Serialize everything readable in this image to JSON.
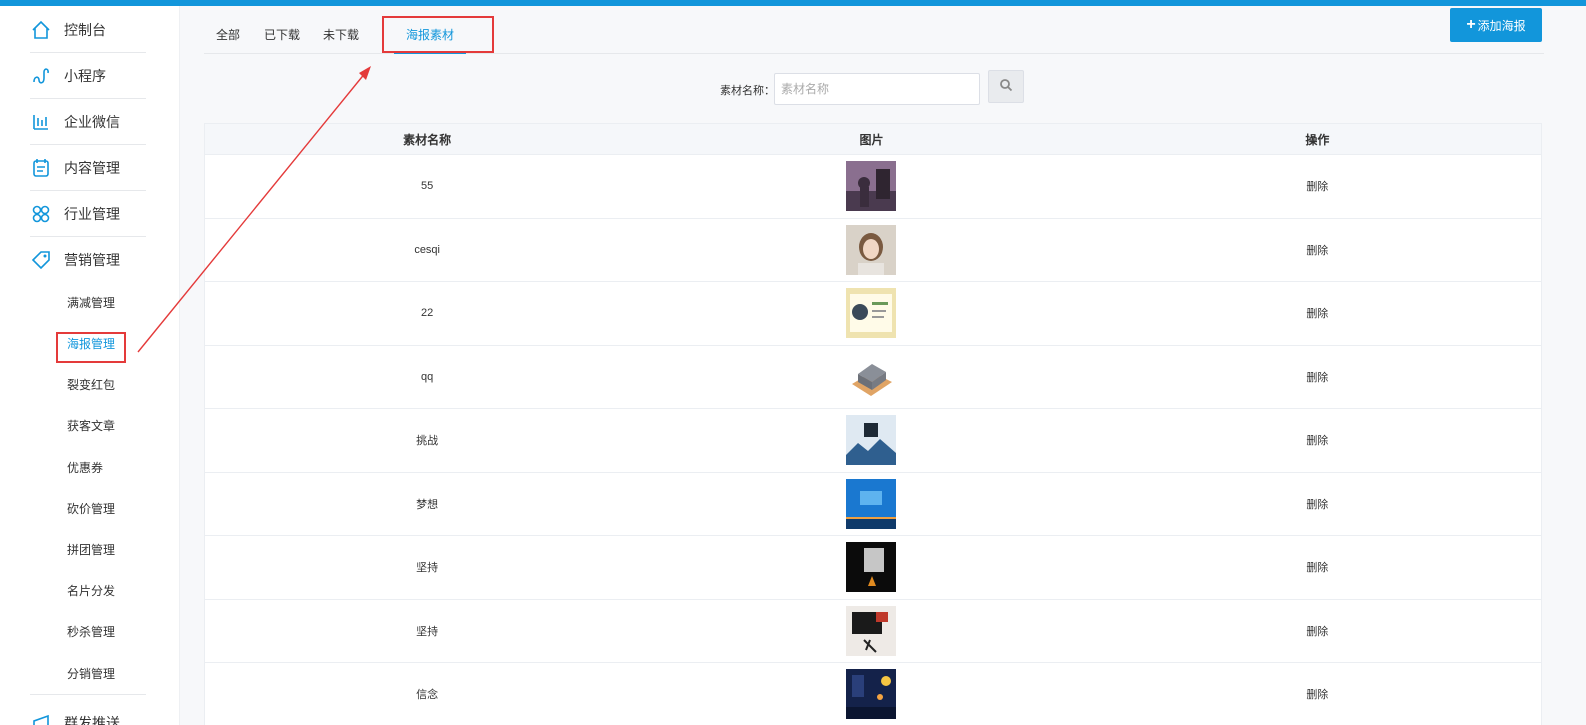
{
  "sidebar": {
    "main_items": [
      {
        "label": "控制台",
        "icon": "home-icon"
      },
      {
        "label": "小程序",
        "icon": "mini-program-icon"
      },
      {
        "label": "企业微信",
        "icon": "enterprise-wechat-icon"
      },
      {
        "label": "内容管理",
        "icon": "content-icon"
      },
      {
        "label": "行业管理",
        "icon": "industry-icon"
      },
      {
        "label": "营销管理",
        "icon": "tag-icon"
      }
    ],
    "sub_items": [
      {
        "label": "满减管理"
      },
      {
        "label": "海报管理"
      },
      {
        "label": "裂变红包"
      },
      {
        "label": "获客文章"
      },
      {
        "label": "优惠券"
      },
      {
        "label": "砍价管理"
      },
      {
        "label": "拼团管理"
      },
      {
        "label": "名片分发"
      },
      {
        "label": "秒杀管理"
      },
      {
        "label": "分销管理"
      }
    ],
    "bottom_item": {
      "label": "群发推送"
    }
  },
  "tabs": [
    {
      "label": "全部"
    },
    {
      "label": "已下载"
    },
    {
      "label": "未下载"
    },
    {
      "label": "海报素材"
    }
  ],
  "add_button": {
    "label": "添加海报",
    "icon": "plus-icon"
  },
  "search": {
    "label": "素材名称：",
    "placeholder": "素材名称",
    "icon": "search-icon"
  },
  "table": {
    "headers": [
      "素材名称",
      "图片",
      "操作"
    ],
    "rows": [
      {
        "name": "55",
        "action": "删除",
        "image": "poster-woman-silhouette"
      },
      {
        "name": "cesqi",
        "action": "删除",
        "image": "poster-girl-portrait"
      },
      {
        "name": "22",
        "action": "删除",
        "image": "poster-business-card"
      },
      {
        "name": "qq",
        "action": "删除",
        "image": "poster-soap-product"
      },
      {
        "name": "挑战",
        "action": "删除",
        "image": "poster-challenge-mountain"
      },
      {
        "name": "梦想",
        "action": "删除",
        "image": "poster-dream-blue"
      },
      {
        "name": "坚持",
        "action": "删除",
        "image": "poster-persist-dark"
      },
      {
        "name": "坚持",
        "action": "删除",
        "image": "poster-persist-ink"
      },
      {
        "name": "信念",
        "action": "删除",
        "image": "poster-faith-night"
      }
    ]
  },
  "colors": {
    "accent": "#1296db",
    "highlight": "#e43a3a"
  }
}
